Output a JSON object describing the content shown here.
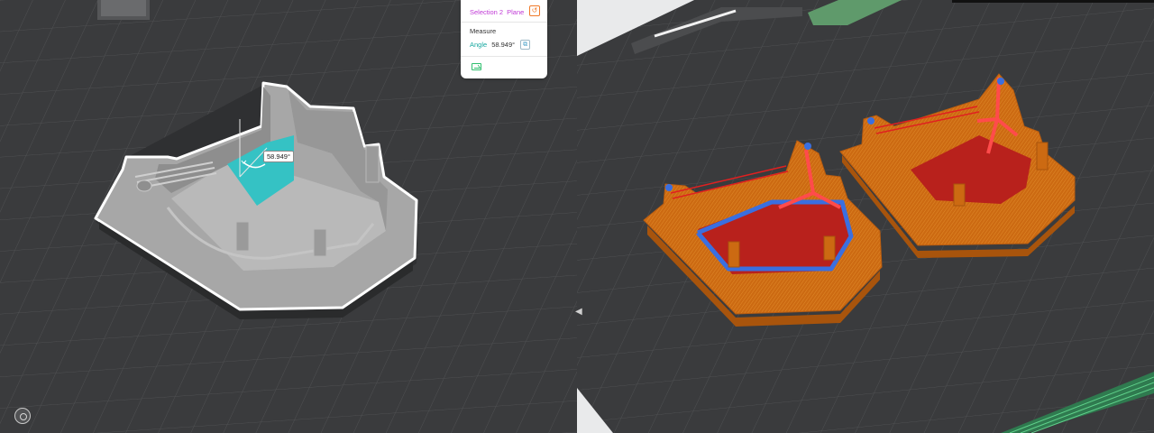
{
  "measure_panel": {
    "selection2_label": "Selection 2",
    "selection2_type": "Plane",
    "section_title": "Measure",
    "angle_label": "Angle",
    "angle_value": "58.949°",
    "icons": {
      "reset": "reset-icon",
      "copy": "copy-icon",
      "export": "export-icon"
    }
  },
  "viewport_left": {
    "angle_annotation": "58.949°",
    "model_color": "#a7a7a7",
    "selected_plane_color": "#35c2c4",
    "outline_color": "#ffffff",
    "orientation_icon": "view-orientation-icon"
  },
  "viewport_right": {
    "infill_color": "#cc6a12",
    "floor_color": "#b8211c",
    "seam_color": "#3a6fe0",
    "support_line_color": "#ff4b4b",
    "bed_print_color": "#3fb36c"
  },
  "colors": {
    "bed": "#3a3b3d",
    "grid": "#4f5052",
    "panel_bg": "#ffffff"
  }
}
